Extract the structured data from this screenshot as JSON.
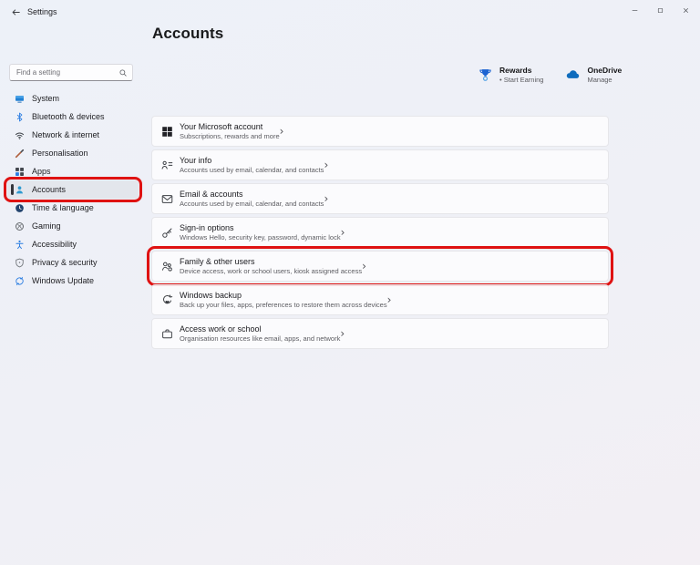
{
  "titlebar": {
    "title": "Settings"
  },
  "window_controls": [
    {
      "name": "minimize",
      "icon": "minimize-icon"
    },
    {
      "name": "maximize",
      "icon": "maximize-icon"
    },
    {
      "name": "close",
      "icon": "close-icon"
    }
  ],
  "page": {
    "title": "Accounts"
  },
  "search": {
    "placeholder": "Find a setting",
    "icon": "search-icon"
  },
  "sidebar": {
    "items": [
      {
        "label": "System",
        "icon": "monitor-icon"
      },
      {
        "label": "Bluetooth & devices",
        "icon": "bluetooth-icon"
      },
      {
        "label": "Network & internet",
        "icon": "wifi-icon"
      },
      {
        "label": "Personalisation",
        "icon": "brush-icon"
      },
      {
        "label": "Apps",
        "icon": "apps-grid-icon"
      },
      {
        "label": "Accounts",
        "icon": "person-icon",
        "selected": true,
        "highlighted": true
      },
      {
        "label": "Time & language",
        "icon": "clock-icon"
      },
      {
        "label": "Gaming",
        "icon": "xbox-icon"
      },
      {
        "label": "Accessibility",
        "icon": "accessibility-icon"
      },
      {
        "label": "Privacy & security",
        "icon": "shield-icon"
      },
      {
        "label": "Windows Update",
        "icon": "update-icon"
      }
    ]
  },
  "header_links": [
    {
      "title": "Rewards",
      "subtitle": "• Start Earning",
      "icon": "trophy-icon"
    },
    {
      "title": "OneDrive",
      "subtitle": "Manage",
      "icon": "cloud-icon"
    }
  ],
  "cards": [
    {
      "title": "Your Microsoft account",
      "subtitle": "Subscriptions, rewards and more",
      "icon": "microsoft-logo-icon"
    },
    {
      "title": "Your info",
      "subtitle": "Accounts used by email, calendar, and contacts",
      "icon": "contact-card-icon"
    },
    {
      "title": "Email & accounts",
      "subtitle": "Accounts used by email, calendar, and contacts",
      "icon": "mail-icon"
    },
    {
      "title": "Sign-in options",
      "subtitle": "Windows Hello, security key, password, dynamic lock",
      "icon": "key-icon"
    },
    {
      "title": "Family & other users",
      "subtitle": "Device access, work or school users, kiosk assigned access",
      "icon": "people-add-icon",
      "highlighted": true
    },
    {
      "title": "Windows backup",
      "subtitle": "Back up your files, apps, preferences to restore them across devices",
      "icon": "backup-icon"
    },
    {
      "title": "Access work or school",
      "subtitle": "Organisation resources like email, apps, and network",
      "icon": "briefcase-icon"
    }
  ],
  "colors": {
    "annotation_red": "#df1212",
    "accent_blue": "#0f6cbd",
    "icon_blue": "#2b7de1"
  }
}
